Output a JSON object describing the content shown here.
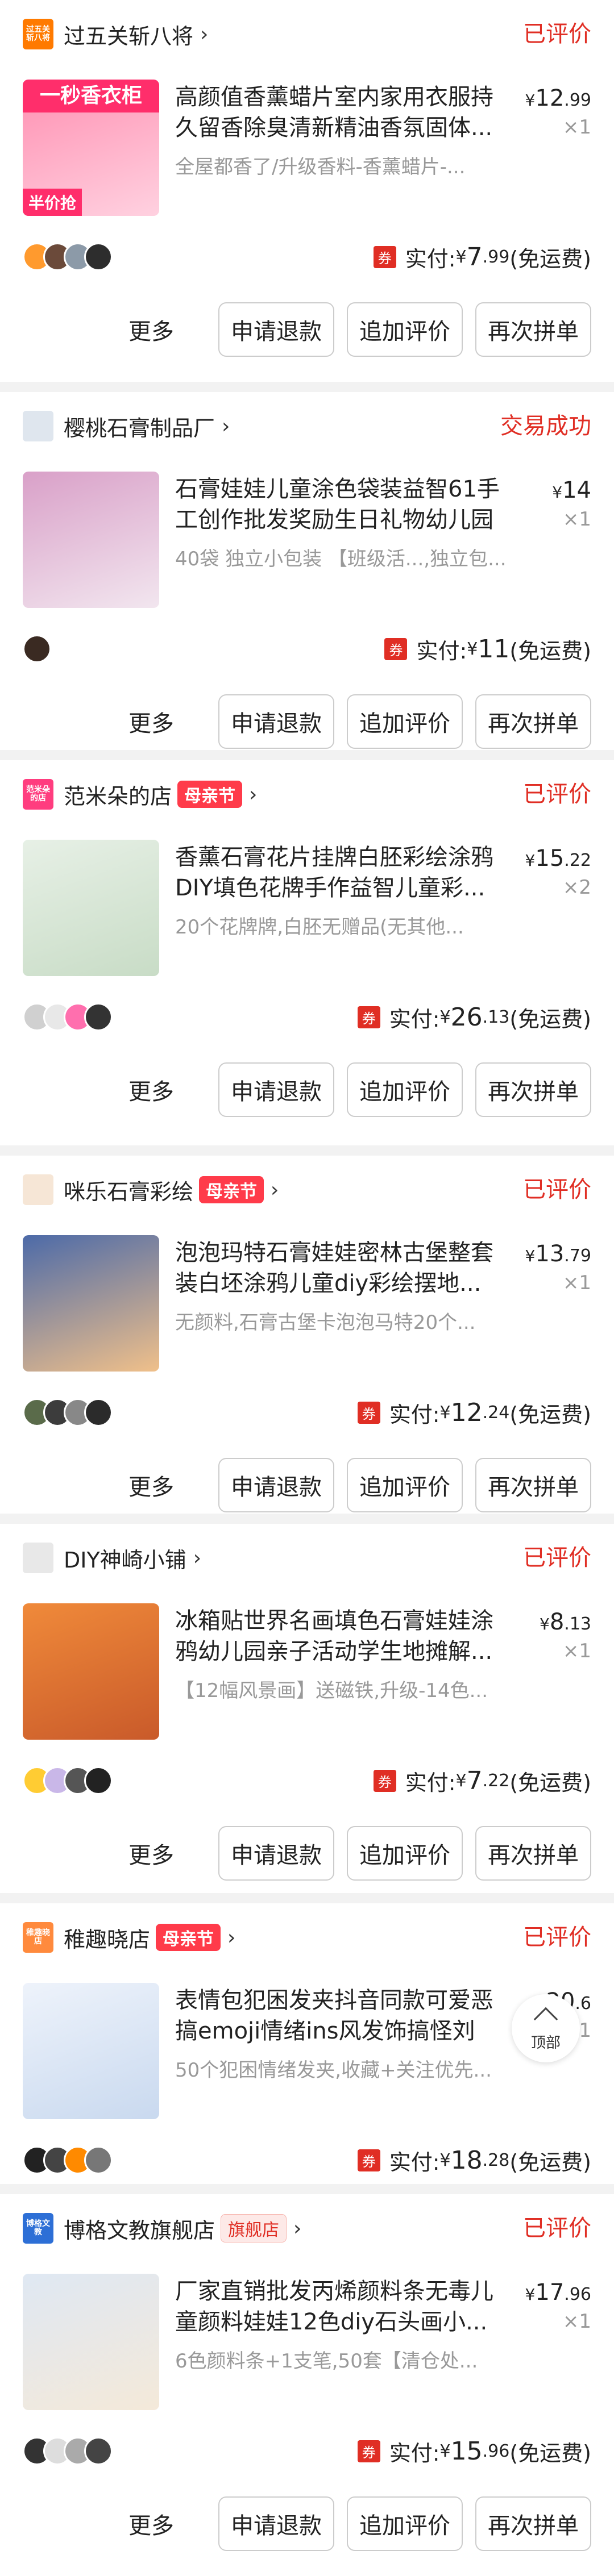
{
  "orders": [
    {
      "shop": "过五关斩八将",
      "badge": "",
      "status": "已评价",
      "logo_text": "过五关斩八将",
      "thumb_text": "一秒香衣柜",
      "thumb_tag": "半价抢",
      "title": "高颜值香薰蜡片室内家用衣服持久留香除臭清新精油香氛固体...",
      "sub": "全屋都香了/升级香料-香薰蜡片-...",
      "price_cur": "¥",
      "price_int": "12",
      "price_dec": ".99",
      "qty": "×1",
      "paid_label": "实付:",
      "paid_cur": "¥",
      "paid_int": "7",
      "paid_dec": ".99",
      "paid_note": "(免运费)",
      "quan": "券",
      "actions": [
        "更多",
        "申请退款",
        "追加评价",
        "再次拼单"
      ]
    },
    {
      "shop": "樱桃石膏制品厂",
      "badge": "",
      "status": "交易成功",
      "logo_text": "",
      "title": "石膏娃娃儿童涂色袋装益智61手工创作批发奖励生日礼物幼儿园摆摊",
      "sub": "40袋 独立小包装 【班级活...,独立包...",
      "price_cur": "¥",
      "price_int": "14",
      "price_dec": "",
      "qty": "×1",
      "paid_label": "实付:",
      "paid_cur": "¥",
      "paid_int": "11",
      "paid_dec": "",
      "paid_note": "(免运费)",
      "quan": "券",
      "actions": [
        "更多",
        "申请退款",
        "追加评价",
        "再次拼单"
      ]
    },
    {
      "shop": "范米朵的店",
      "badge": "母亲节",
      "status": "已评价",
      "logo_text": "范米朵的店",
      "title": "香薰石膏花片挂牌白胚彩绘涂鸦DIY填色花牌手作益智儿童彩...",
      "sub": "20个花牌牌,白胚无赠品(无其他...",
      "price_cur": "¥",
      "price_int": "15",
      "price_dec": ".22",
      "qty": "×2",
      "paid_label": "实付:",
      "paid_cur": "¥",
      "paid_int": "26",
      "paid_dec": ".13",
      "paid_note": "(免运费)",
      "quan": "券",
      "actions": [
        "更多",
        "申请退款",
        "追加评价",
        "再次拼单"
      ]
    },
    {
      "shop": "咪乐石膏彩绘",
      "badge": "母亲节",
      "status": "已评价",
      "logo_text": "",
      "title": "泡泡玛特石膏娃娃密林古堡整套装白坯涂鸦儿童diy彩绘摆地...",
      "sub": "无颜料,石膏古堡卡泡泡马特20个...",
      "price_cur": "¥",
      "price_int": "13",
      "price_dec": ".79",
      "qty": "×1",
      "paid_label": "实付:",
      "paid_cur": "¥",
      "paid_int": "12",
      "paid_dec": ".24",
      "paid_note": "(免运费)",
      "quan": "券",
      "actions": [
        "更多",
        "申请退款",
        "追加评价",
        "再次拼单"
      ]
    },
    {
      "shop": "DIY神崎小铺",
      "badge": "",
      "status": "已评价",
      "logo_text": "",
      "title": "冰箱贴世界名画填色石膏娃娃涂鸦幼儿园亲子活动学生地摊解...",
      "sub": "【12幅风景画】送磁铁,升级-14色...",
      "price_cur": "¥",
      "price_int": "8",
      "price_dec": ".13",
      "qty": "×1",
      "paid_label": "实付:",
      "paid_cur": "¥",
      "paid_int": "7",
      "paid_dec": ".22",
      "paid_note": "(免运费)",
      "quan": "券",
      "actions": [
        "更多",
        "申请退款",
        "追加评价",
        "再次拼单"
      ]
    },
    {
      "shop": "稚趣晓店",
      "badge": "母亲节",
      "status": "已评价",
      "logo_text": "稚趣晓店",
      "title": "表情包犯困发夹抖音同款可爱恶搞emoji情绪ins风发饰搞怪刘海...",
      "sub": "50个犯困情绪发夹,收藏+关注优先...",
      "price_cur": "¥",
      "price_int": "20",
      "price_dec": ".6",
      "qty": "×1",
      "paid_label": "实付:",
      "paid_cur": "¥",
      "paid_int": "18",
      "paid_dec": ".28",
      "paid_note": "(免运费)",
      "quan": "券",
      "actions": []
    },
    {
      "shop": "博格文教旗舰店",
      "badge": "旗舰店",
      "status": "已评价",
      "logo_text": "博格文教",
      "title": "厂家直销批发丙烯颜料条无毒儿童颜料娃娃12色diy石头画小...",
      "sub": "6色颜料条+1支笔,50套【清仓处...",
      "price_cur": "¥",
      "price_int": "17",
      "price_dec": ".96",
      "qty": "×1",
      "paid_label": "实付:",
      "paid_cur": "¥",
      "paid_int": "15",
      "paid_dec": ".96",
      "paid_note": "(免运费)",
      "quan": "券",
      "actions": [
        "更多",
        "申请退款",
        "追加评价",
        "再次拼单"
      ]
    }
  ],
  "back_to_top": "顶部",
  "colors": {
    "accent": "#e02e24",
    "badge": "#ff3b4a"
  }
}
